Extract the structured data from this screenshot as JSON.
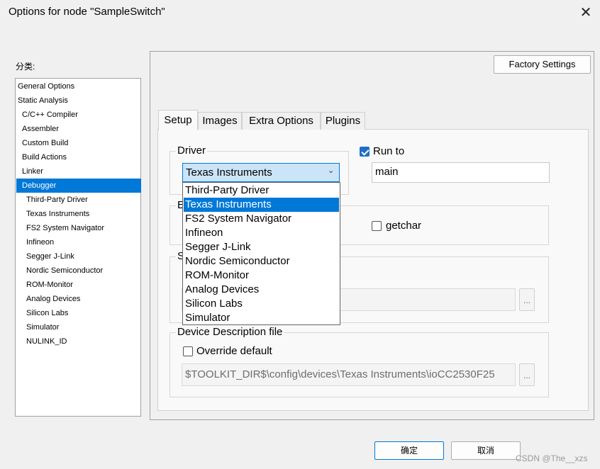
{
  "window": {
    "title": "Options for node \"SampleSwitch\""
  },
  "category": {
    "label": "分类:",
    "items": [
      {
        "label": "General Options"
      },
      {
        "label": "Static Analysis"
      },
      {
        "label": "C/C++ Compiler"
      },
      {
        "label": "Assembler"
      },
      {
        "label": "Custom Build"
      },
      {
        "label": "Build Actions"
      },
      {
        "label": "Linker"
      },
      {
        "label": "Debugger"
      },
      {
        "label": "Third-Party Driver"
      },
      {
        "label": "Texas Instruments"
      },
      {
        "label": "FS2 System Navigator"
      },
      {
        "label": "Infineon"
      },
      {
        "label": "Segger J-Link"
      },
      {
        "label": "Nordic Semiconductor"
      },
      {
        "label": "ROM-Monitor"
      },
      {
        "label": "Analog Devices"
      },
      {
        "label": "Silicon Labs"
      },
      {
        "label": "Simulator"
      },
      {
        "label": "NULINK_ID"
      }
    ],
    "selected": "Debugger"
  },
  "factory_settings_label": "Factory Settings",
  "tabs": [
    {
      "label": "Setup"
    },
    {
      "label": "Images"
    },
    {
      "label": "Extra Options"
    },
    {
      "label": "Plugins"
    }
  ],
  "setup": {
    "driver_group_label": "Driver",
    "driver_value": "Texas Instruments",
    "driver_options": [
      {
        "label": "Third-Party Driver"
      },
      {
        "label": "Texas Instruments"
      },
      {
        "label": "FS2 System Navigator"
      },
      {
        "label": "Infineon"
      },
      {
        "label": "Segger J-Link"
      },
      {
        "label": "Nordic Semiconductor"
      },
      {
        "label": "ROM-Monitor"
      },
      {
        "label": "Analog Devices"
      },
      {
        "label": "Silicon Labs"
      },
      {
        "label": "Simulator"
      }
    ],
    "run_to_label": "Run to",
    "run_to_checked": true,
    "run_to_value": "main",
    "emulation_group_partial": "E",
    "getchar_label": "getchar",
    "getchar_checked": false,
    "setup_macros_group_partial": "S",
    "setup_macros_ellipsis": "...",
    "ddf_group_label": "Device Description file",
    "override_label": "Override default",
    "override_checked": false,
    "ddf_path": "$TOOLKIT_DIR$\\config\\devices\\Texas Instruments\\ioCC2530F25",
    "ddf_ellipsis": "..."
  },
  "buttons": {
    "ok": "确定",
    "cancel": "取消"
  },
  "watermark": "CSDN @The__xzs",
  "colors": {
    "selection": "#0078d7",
    "checkbox_on": "#1f6fc5"
  },
  "icons": {
    "close": "close-icon",
    "dropdown_arrow": "chevron-down-icon"
  }
}
